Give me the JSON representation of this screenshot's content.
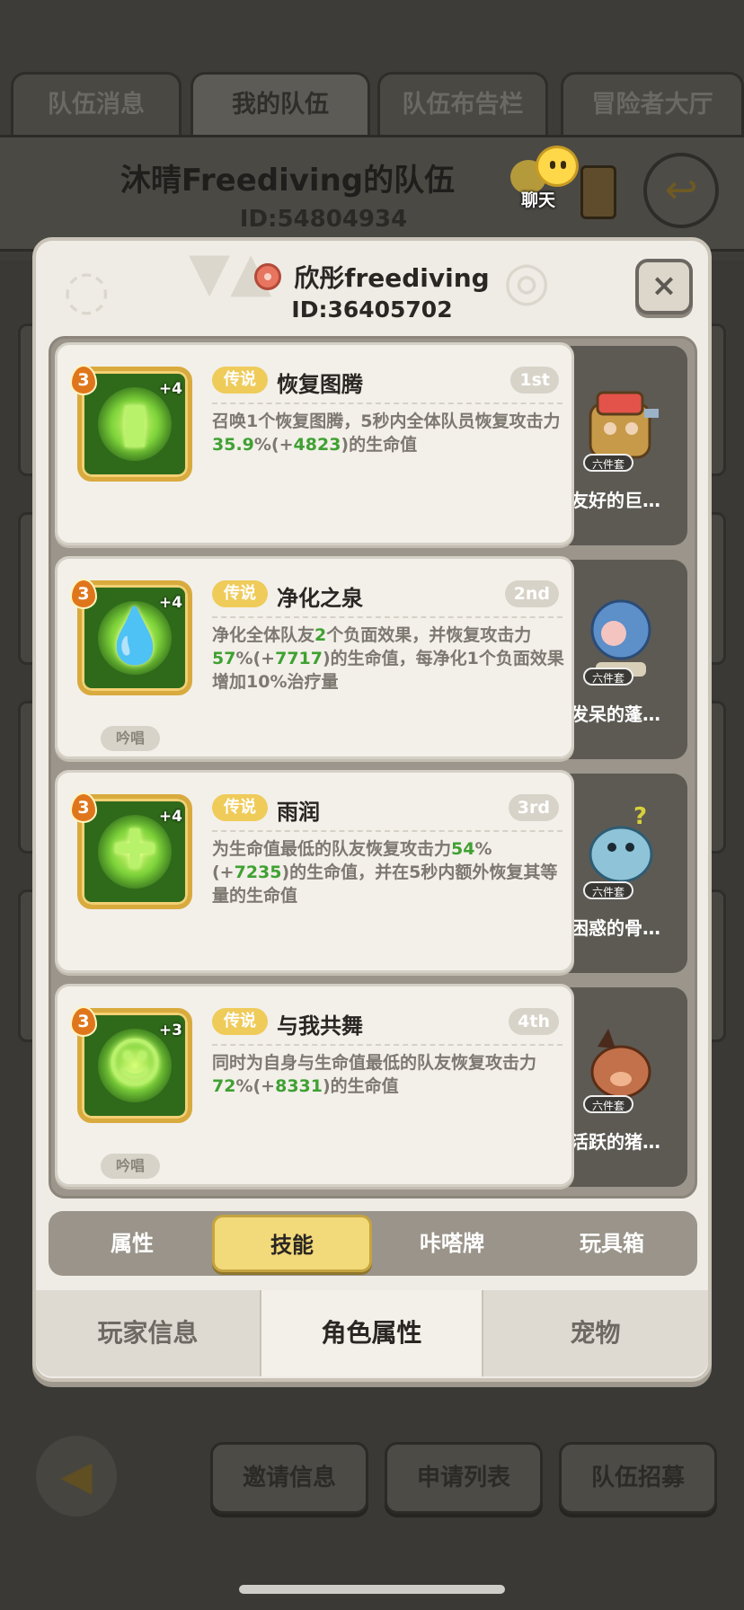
{
  "top_tabs": [
    "队伍消息",
    "我的队伍",
    "队伍布告栏",
    "冒险者大厅"
  ],
  "team": {
    "name": "沐晴Freediving的队伍",
    "id": "ID:54804934",
    "chat_label": "聊天"
  },
  "player": {
    "name": "欣彤freediving",
    "id": "ID:36405702",
    "close_label": "×"
  },
  "skills": [
    {
      "level": "3",
      "plus": "+4",
      "rarity": "传说",
      "name": "恢复图腾",
      "rank": "1st",
      "desc": [
        "召唤1个恢复图腾，5秒内全体队员恢复攻击力",
        "35.9",
        "%(+",
        "4823",
        ")的生命值"
      ],
      "chant": "",
      "pet": {
        "label": "友好的巨…",
        "badge": "六件套"
      }
    },
    {
      "level": "3",
      "plus": "+4",
      "rarity": "传说",
      "name": "净化之泉",
      "rank": "2nd",
      "desc": [
        "净化全体队友",
        "2",
        "个负面效果，并恢复攻击力",
        "57",
        "%(+",
        "7717",
        ")的生命值，每净化1个负面效果增加10%治疗量"
      ],
      "chant": "吟唱",
      "pet": {
        "label": "发呆的蓬…",
        "badge": "六件套"
      }
    },
    {
      "level": "3",
      "plus": "+4",
      "rarity": "传说",
      "name": "雨润",
      "rank": "3rd",
      "desc": [
        "为生命值最低的队友恢复攻击力",
        "54",
        "%(+",
        "7235",
        ")的生命值，并在5秒内额外恢复其等量的生命值"
      ],
      "chant": "",
      "pet": {
        "label": "困惑的骨…",
        "badge": "六件套"
      }
    },
    {
      "level": "3",
      "plus": "+3",
      "rarity": "传说",
      "name": "与我共舞",
      "rank": "4th",
      "desc": [
        "同时为自身与生命值最低的队友恢复攻击力",
        "72",
        "%(+",
        "8331",
        ")的生命值"
      ],
      "chant": "吟唱",
      "pet": {
        "label": "活跃的猪…",
        "badge": "六件套"
      }
    }
  ],
  "sub_tabs": [
    "属性",
    "技能",
    "咔嗒牌",
    "玩具箱"
  ],
  "sub_tab_active": "技能",
  "modal_tabs": [
    "玩家信息",
    "角色属性",
    "宠物"
  ],
  "modal_tab_active": "角色属性",
  "bottom_buttons": [
    "邀请信息",
    "申请列表",
    "队伍招募"
  ],
  "colors": {
    "accent_gold": "#efcb5a",
    "value_green": "#3fa132",
    "panel_bg": "#efece6"
  }
}
